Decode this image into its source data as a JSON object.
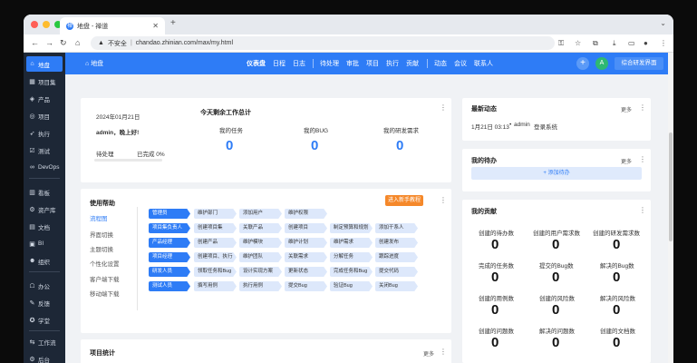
{
  "browser": {
    "tab_title": "地盘 - 禅道",
    "url": "chandao.zhinian.com/max/my.html",
    "insecure_label": "不安全"
  },
  "sidebar": {
    "items": [
      {
        "icon": "home-icon",
        "label": "地盘"
      },
      {
        "icon": "grid-icon",
        "label": "项目集"
      },
      {
        "icon": "bulb-icon",
        "label": "产品"
      },
      {
        "icon": "target-icon",
        "label": "项目"
      },
      {
        "icon": "send-icon",
        "label": "执行"
      },
      {
        "icon": "check-icon",
        "label": "测试"
      },
      {
        "icon": "infinity-icon",
        "label": "DevOps"
      },
      {
        "icon": "board-icon",
        "label": "看板"
      },
      {
        "icon": "asset-icon",
        "label": "资产库"
      },
      {
        "icon": "doc-icon",
        "label": "文档"
      },
      {
        "icon": "bi-icon",
        "label": "BI"
      },
      {
        "icon": "org-icon",
        "label": "组织"
      },
      {
        "icon": "office-icon",
        "label": "办公"
      },
      {
        "icon": "feedback-icon",
        "label": "反馈"
      },
      {
        "icon": "academy-icon",
        "label": "学堂"
      },
      {
        "icon": "flow-icon",
        "label": "工作流"
      },
      {
        "icon": "admin-icon",
        "label": "后台"
      }
    ]
  },
  "topnav": {
    "home": "地盘",
    "items": [
      "仪表盘",
      "日程",
      "日志",
      "待处理",
      "审批",
      "项目",
      "执行",
      "贡献",
      "动态",
      "会议",
      "联系人"
    ],
    "avatar": "A",
    "comprehensive": "综合研发界面"
  },
  "welcome": {
    "date": "2024年01月21日",
    "greeting": "admin，晚上好!",
    "pending": "待处理",
    "completed": "已完成 0%",
    "progress_percent": 0,
    "today_title": "今天剩余工作总计",
    "stats": [
      {
        "label": "我的任务",
        "value": "0"
      },
      {
        "label": "我的BUG",
        "value": "0"
      },
      {
        "label": "我的研发需求",
        "value": "0"
      }
    ]
  },
  "latest": {
    "title": "最新动态",
    "more": "更多",
    "entry": {
      "time": "1月21日 03:13",
      "user": "admin",
      "action": "登录系统"
    }
  },
  "todo": {
    "title": "我的待办",
    "more": "更多",
    "add": "+ 添加待办"
  },
  "contrib": {
    "title": "我的贡献",
    "items": [
      {
        "label": "创建的待办数",
        "value": "0"
      },
      {
        "label": "创建的用户需求数",
        "value": "0"
      },
      {
        "label": "创建的研发需求数",
        "value": "0"
      },
      {
        "label": "完成的任务数",
        "value": "0"
      },
      {
        "label": "提交的Bug数",
        "value": "0"
      },
      {
        "label": "解决的Bug数",
        "value": "0"
      },
      {
        "label": "创建的用例数",
        "value": "0"
      },
      {
        "label": "创建的风险数",
        "value": "0"
      },
      {
        "label": "解决的风险数",
        "value": "0"
      },
      {
        "label": "创建的问题数",
        "value": "0"
      },
      {
        "label": "解决的问题数",
        "value": "0"
      },
      {
        "label": "创建的文档数",
        "value": "0"
      }
    ]
  },
  "help": {
    "title": "使用帮助",
    "guide_button": "进入新手教程",
    "nav": [
      "流程图",
      "界面切换",
      "主题切换",
      "个性化设置",
      "客户端下载",
      "移动端下载"
    ],
    "rows": [
      [
        "管理员",
        "维护部门",
        "添加用户",
        "维护权限"
      ],
      [
        "项目集负责人",
        "创建项目集",
        "关联产品",
        "创建项目",
        "制定预算和规划",
        "添加干系人"
      ],
      [
        "产品经理",
        "创建产品",
        "维护模块",
        "维护计划",
        "维护需求",
        "创建发布"
      ],
      [
        "项目经理",
        "创建项目、执行",
        "维护团队",
        "关联需求",
        "分解任务",
        "跟踪进度"
      ],
      [
        "研发人员",
        "领取任务和Bug",
        "设计实现方案",
        "更新状态",
        "完成任务和Bug",
        "提交代码"
      ],
      [
        "测试人员",
        "撰写用例",
        "执行用例",
        "提交Bug",
        "验证Bug",
        "关闭Bug"
      ]
    ]
  },
  "project_stats": {
    "title": "项目统计",
    "more": "更多"
  }
}
